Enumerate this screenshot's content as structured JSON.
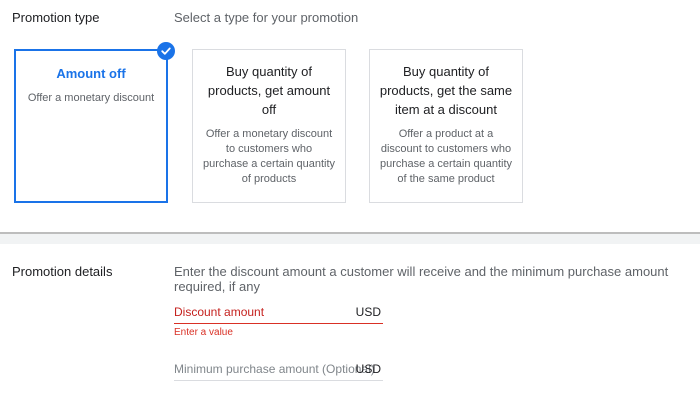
{
  "promotion_type": {
    "label": "Promotion type",
    "description": "Select a type for your promotion",
    "cards": [
      {
        "title": "Amount off",
        "description": "Offer a monetary discount",
        "selected": true
      },
      {
        "title": "Buy quantity of products, get amount off",
        "description": "Offer a monetary discount to customers who purchase a certain quantity of products",
        "selected": false
      },
      {
        "title": "Buy quantity of products, get the same item at a discount",
        "description": "Offer a product at a discount to customers who purchase a certain quantity of the same product",
        "selected": false
      }
    ],
    "selected_icon": "check-circle-icon"
  },
  "promotion_details": {
    "label": "Promotion details",
    "description": "Enter the discount amount a customer will receive and the minimum purchase amount required, if any",
    "discount_field": {
      "placeholder": "Discount amount",
      "suffix": "USD",
      "error": "Enter a value"
    },
    "minimum_field": {
      "placeholder": "Minimum purchase amount (Optional)",
      "suffix": "USD"
    }
  },
  "colors": {
    "accent": "#1a73e8",
    "error": "#d93025",
    "border": "#dadce0"
  }
}
